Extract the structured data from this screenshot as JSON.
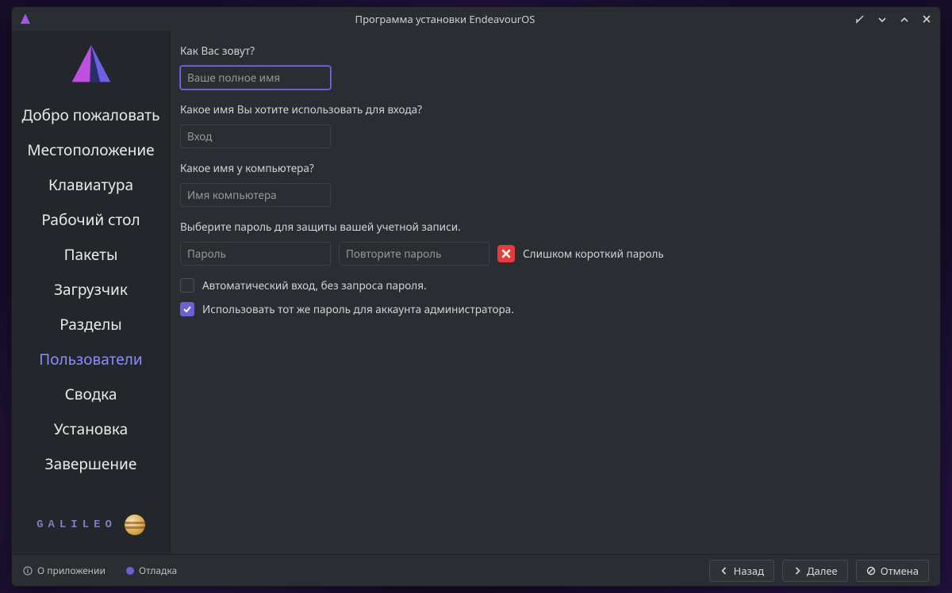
{
  "window": {
    "title": "Программа установки EndeavourOS"
  },
  "sidebar": {
    "steps": [
      "Добро пожаловать",
      "Местоположение",
      "Клавиатура",
      "Рабочий стол",
      "Пакеты",
      "Загрузчик",
      "Разделы",
      "Пользователи",
      "Сводка",
      "Установка",
      "Завершение"
    ],
    "active_index": 7,
    "branding": "GALILEO"
  },
  "form": {
    "name_label": "Как Вас зовут?",
    "name_placeholder": "Ваше полное имя",
    "login_label": "Какое имя Вы хотите использовать для входа?",
    "login_placeholder": "Вход",
    "host_label": "Какое имя у компьютера?",
    "host_placeholder": "Имя компьютера",
    "password_label": "Выберите пароль для защиты вашей учетной записи.",
    "password_placeholder": "Пароль",
    "password_repeat_placeholder": "Повторите пароль",
    "password_error": "Слишком короткий пароль",
    "autologin_label": "Автоматический вход, без запроса пароля.",
    "reuse_admin_label": "Использовать тот же пароль для аккаунта администратора.",
    "autologin_checked": false,
    "reuse_admin_checked": true
  },
  "footer": {
    "about": "О приложении",
    "debug": "Отладка",
    "back": "Назад",
    "next": "Далее",
    "cancel": "Отмена"
  }
}
